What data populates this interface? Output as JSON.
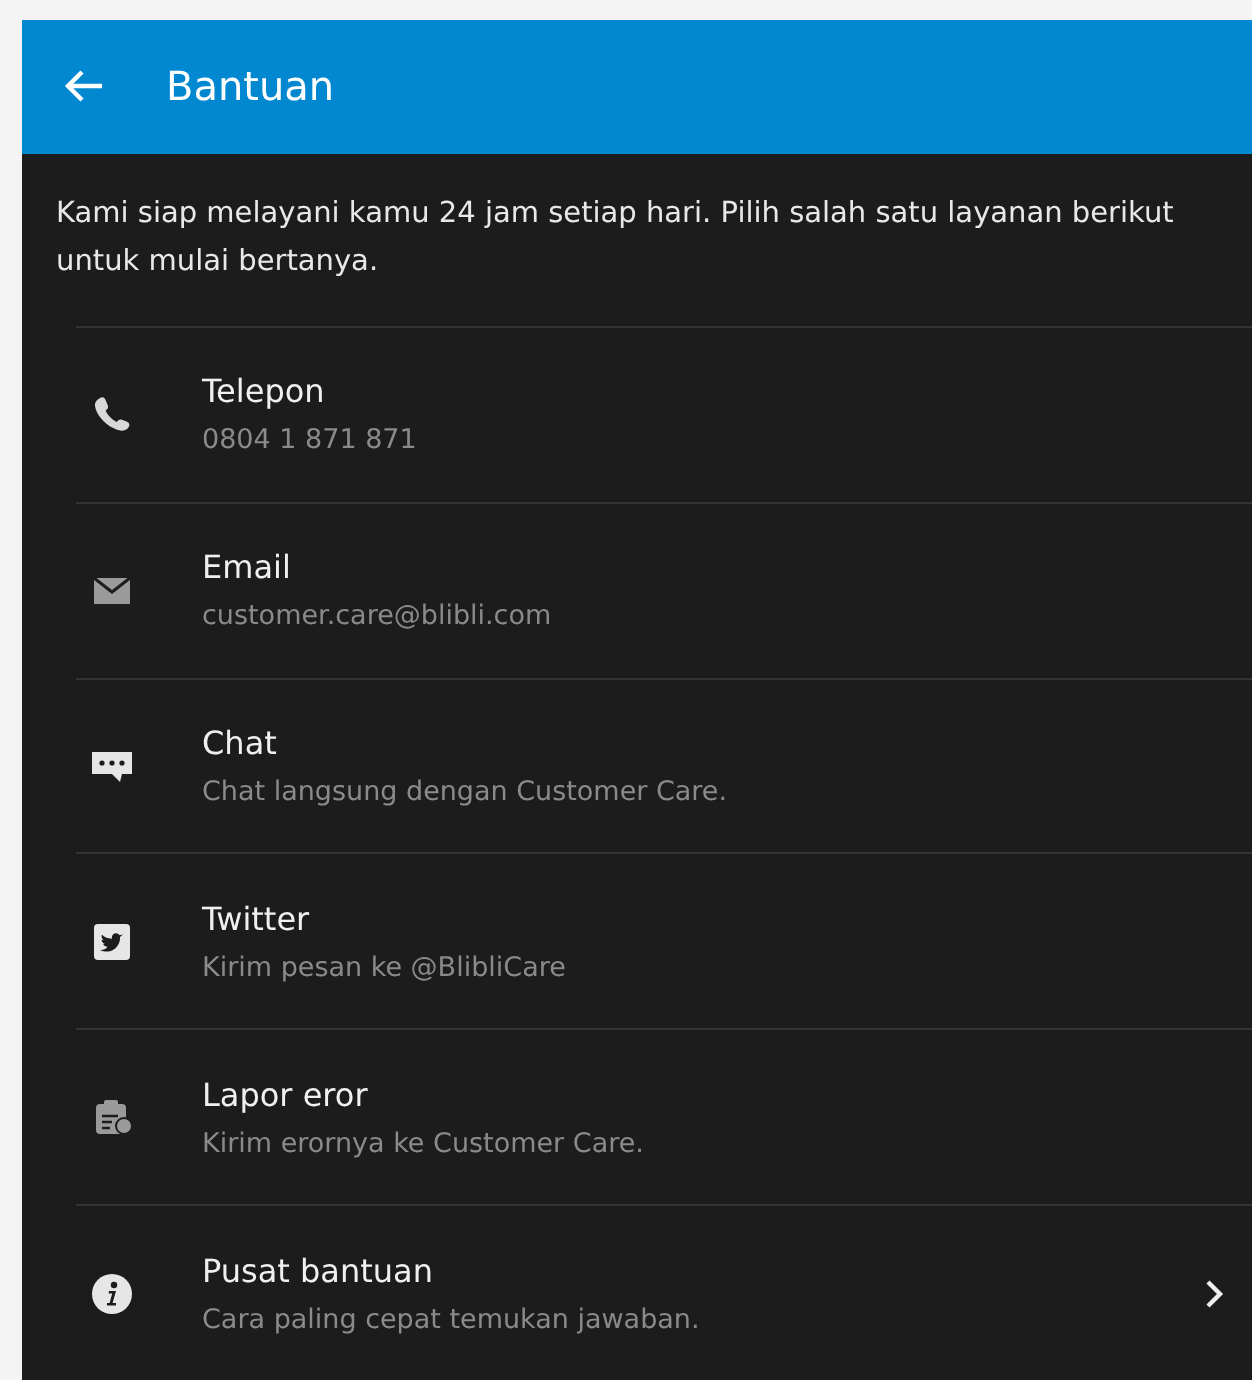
{
  "app_bar": {
    "title": "Bantuan"
  },
  "intro": "Kami siap melayani kamu 24 jam setiap hari. Pilih salah satu layanan berikut untuk mulai bertanya.",
  "items": [
    {
      "kind": "phone",
      "title": "Telepon",
      "subtitle": "0804 1 871 871",
      "chevron": false
    },
    {
      "kind": "email",
      "title": "Email",
      "subtitle": "customer.care@blibli.com",
      "chevron": false
    },
    {
      "kind": "chat",
      "title": "Chat",
      "subtitle": "Chat langsung dengan Customer Care.",
      "chevron": false
    },
    {
      "kind": "twitter",
      "title": "Twitter",
      "subtitle": "Kirim pesan ke @BlibliCare",
      "chevron": false
    },
    {
      "kind": "report",
      "title": "Lapor eror",
      "subtitle": "Kirim erornya ke Customer Care.",
      "chevron": false
    },
    {
      "kind": "info",
      "title": "Pusat bantuan",
      "subtitle": "Cara paling cepat temukan jawaban.",
      "chevron": true
    }
  ]
}
